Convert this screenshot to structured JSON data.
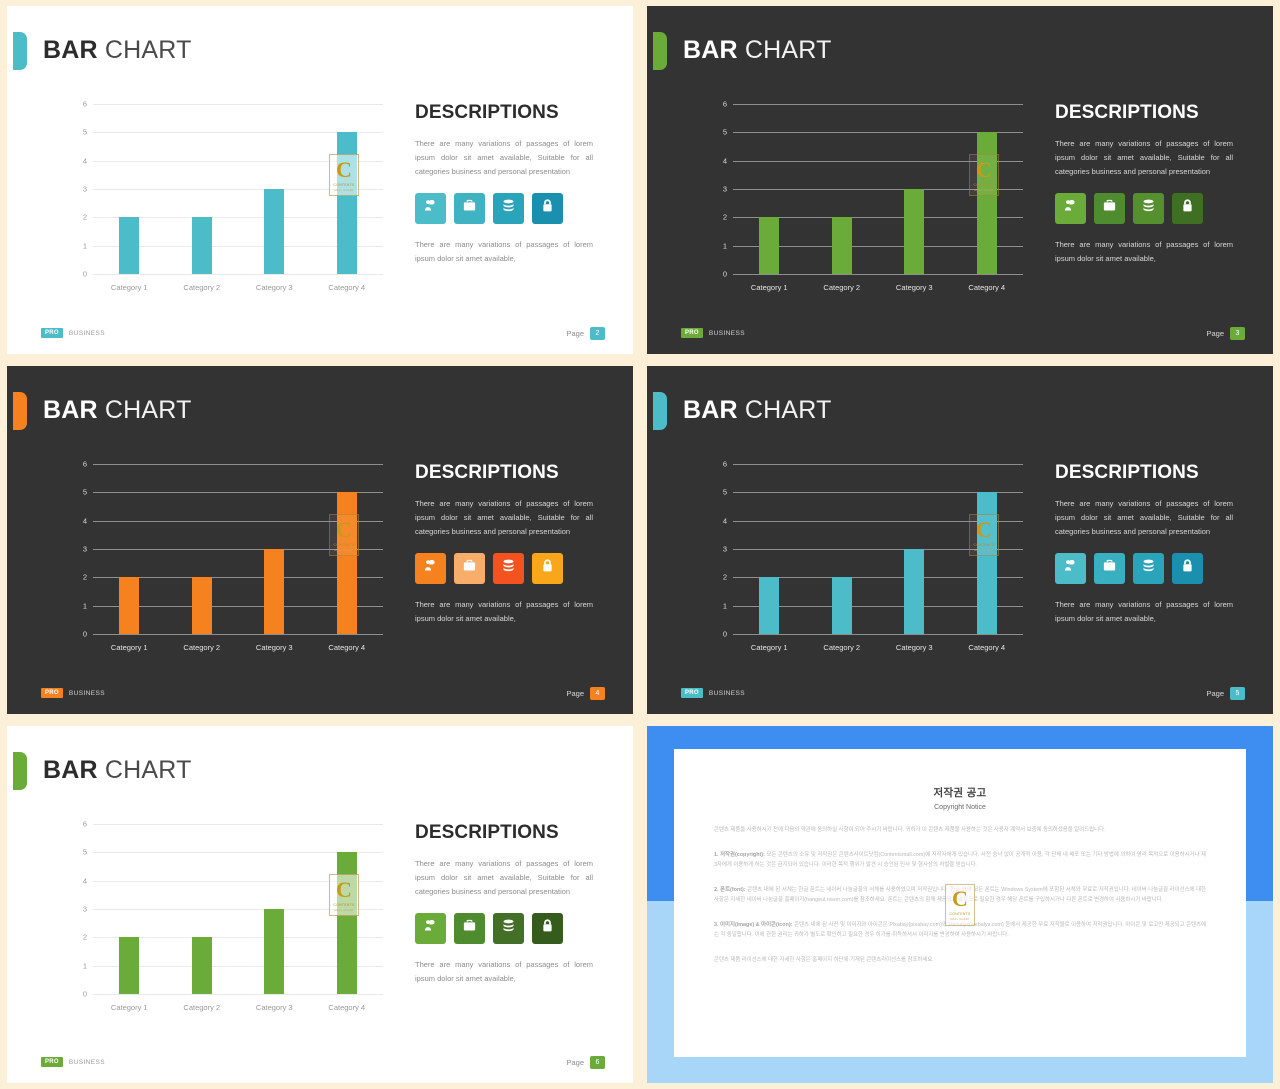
{
  "common": {
    "title_bold": "BAR",
    "title_light": " CHART",
    "descriptions_heading": "DESCRIPTIONS",
    "desc_paragraph_1": "There are many variations of passages of lorem ipsum dolor sit amet available, Suitable for all categories business and personal presentation",
    "desc_paragraph_2": "There are many variations of passages of lorem ipsum dolor sit amet available,",
    "pro_badge": "PRO",
    "business_label": "BUSINESS",
    "page_word": "Page",
    "icons": [
      "presenter-icon",
      "briefcase-icon",
      "database-icon",
      "unlock-icon"
    ],
    "watermark": {
      "letter": "C",
      "sub1": "CONTENTS",
      "sub2": "MALL CHART"
    }
  },
  "chart_data": {
    "type": "bar",
    "title": "BAR CHART",
    "categories": [
      "Category 1",
      "Category 2",
      "Category 3",
      "Category 4"
    ],
    "values": [
      2,
      2,
      3,
      5
    ],
    "yticks": [
      6,
      5,
      4,
      3,
      2,
      1,
      0
    ],
    "ylim": [
      0,
      6
    ],
    "xlabel": "",
    "ylabel": "",
    "grid": true,
    "legend": "none"
  },
  "slides": [
    {
      "id": "slide-teal-light",
      "theme": "light",
      "page": "2",
      "accent": "#4cbcc8",
      "bar_color": "#4cbcc8",
      "icon_colors": [
        "#4cbcc8",
        "#3fb3c2",
        "#2aa4bb",
        "#1b8fae"
      ],
      "badge_color": "#4cbcc8",
      "page_color": "#4cbcc8"
    },
    {
      "id": "slide-green-dark",
      "theme": "dark",
      "page": "3",
      "accent": "#6aab3a",
      "bar_color": "#6aab3a",
      "icon_colors": [
        "#6aab3a",
        "#4f8c30",
        "#568f2e",
        "#3f6f22"
      ],
      "badge_color": "#6aab3a",
      "page_color": "#6aab3a"
    },
    {
      "id": "slide-orange-dark",
      "theme": "dark",
      "page": "4",
      "accent": "#f5821f",
      "bar_color": "#f5821f",
      "icon_colors": [
        "#f5821f",
        "#f8ad6b",
        "#f4521e",
        "#f9a61a"
      ],
      "badge_color": "#f5821f",
      "page_color": "#f5821f"
    },
    {
      "id": "slide-teal-dark",
      "theme": "dark",
      "page": "5",
      "accent": "#4cbcc8",
      "bar_color": "#4cbcc8",
      "icon_colors": [
        "#4cbcc8",
        "#38b0c0",
        "#2aa4bb",
        "#1b8fae"
      ],
      "badge_color": "#4cbcc8",
      "page_color": "#4cbcc8"
    },
    {
      "id": "slide-green-light",
      "theme": "light",
      "page": "6",
      "accent": "#6aab3a",
      "bar_color": "#6aab3a",
      "icon_colors": [
        "#6aab3a",
        "#4f8c30",
        "#446f26",
        "#355c1c"
      ],
      "badge_color": "#6aab3a",
      "page_color": "#6aab3a"
    }
  ],
  "copyright": {
    "title_ko": "저작권 공고",
    "title_en": "Copyright Notice",
    "intro": "콘텐츠 제품을 사용하시기 전에 다음의 약관에 동의하실 사항이 되어 주시기 바랍니다. 귀하가 이 콘텐츠 제품을 사용하는 것은 사용자 계약서 보증에 동의하셨음을 알려드립니다.",
    "item1_label": "1. 저작권(copyright):",
    "item1_text": "모든 콘텐츠의 소유 및 저작권은 콘텐츠사이트닷컴(Contentsmall.com)에 저작자에게 있습니다. 사전 승낙 없이 공개적 이용, 각 단체 내 배포 또는 기타 방법에 의하여 영리 목적으로 이용하시거나 제3자에게 이용하게 하는 것은 금지되어 있습니다. 이러한 목적 행위가 발견 시 승인된 민사 및 형사상의 처벌을 받습니다.",
    "item2_label": "2. 폰트(font):",
    "item2_text": "콘텐츠 내에 된 서체는 한글 폰트는 네이버 나눔글꼴의 서체를 사용하였으며 저작권입니다. 한글 외의 모든 폰트는 Windows System에 포함된 서체와 무료로 저작권입니다. 네이버 나눔글꼴 라이선스에 대한 사항은 자세한 네이버 나눔글꼴 홈페이지(hangeul.naver.com)를 참조하세요. 폰트는 콘텐츠의 함께 제공되지 않으므로 필요한 경우 해당 폰트를 구입하시거나 다른 폰트로 변경하여 사용하시기 바랍니다.",
    "item3_label": "3. 이미지(image) & 아이콘(icon):",
    "item3_text": "콘텐츠 내에 된 사진 및 이미지와 아이콘은 Pixabay(pixabay.com)와 Webalys(webalys.com) 등에서 제공한 무료 저작물로 이용하여 저작권입니다. 아이콘 및 로고만 제공되고 콘텐츠에는 각 동일합니다. 이에 관한 권리는 귀하가 별도로 확인하고 필요한 경우 허가를 취득하셔서 이미지를 변경하여 사용하시기 바랍니다.",
    "footer": "콘텐츠 제품 라이선스에 대한 자세한 사항은 홈페이지 하단에 기재된 콘텐츠라이선스를 참조하세요."
  }
}
